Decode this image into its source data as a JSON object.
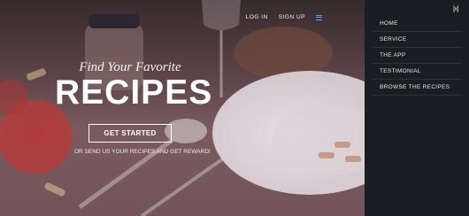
{
  "nav": {
    "login": "LOG IN",
    "signup": "SIGN UP"
  },
  "hero": {
    "tagline": "Find Your Favorite",
    "headline": "RECIPES",
    "cta": "GET STARTED",
    "subtext": "OR SEND US YOUR RECIPES AND GET REWARD!"
  },
  "side_menu": {
    "close": "[x]",
    "items": [
      {
        "label": "HOME"
      },
      {
        "label": "SERVICE"
      },
      {
        "label": "THE APP"
      },
      {
        "label": "TESTIMONIAL"
      },
      {
        "label": "BROWSE THE RECIPES"
      }
    ]
  },
  "colors": {
    "menu_bg": "#1a1e22",
    "hamburger": "#4da6ff",
    "text_light": "#f2eef0"
  }
}
